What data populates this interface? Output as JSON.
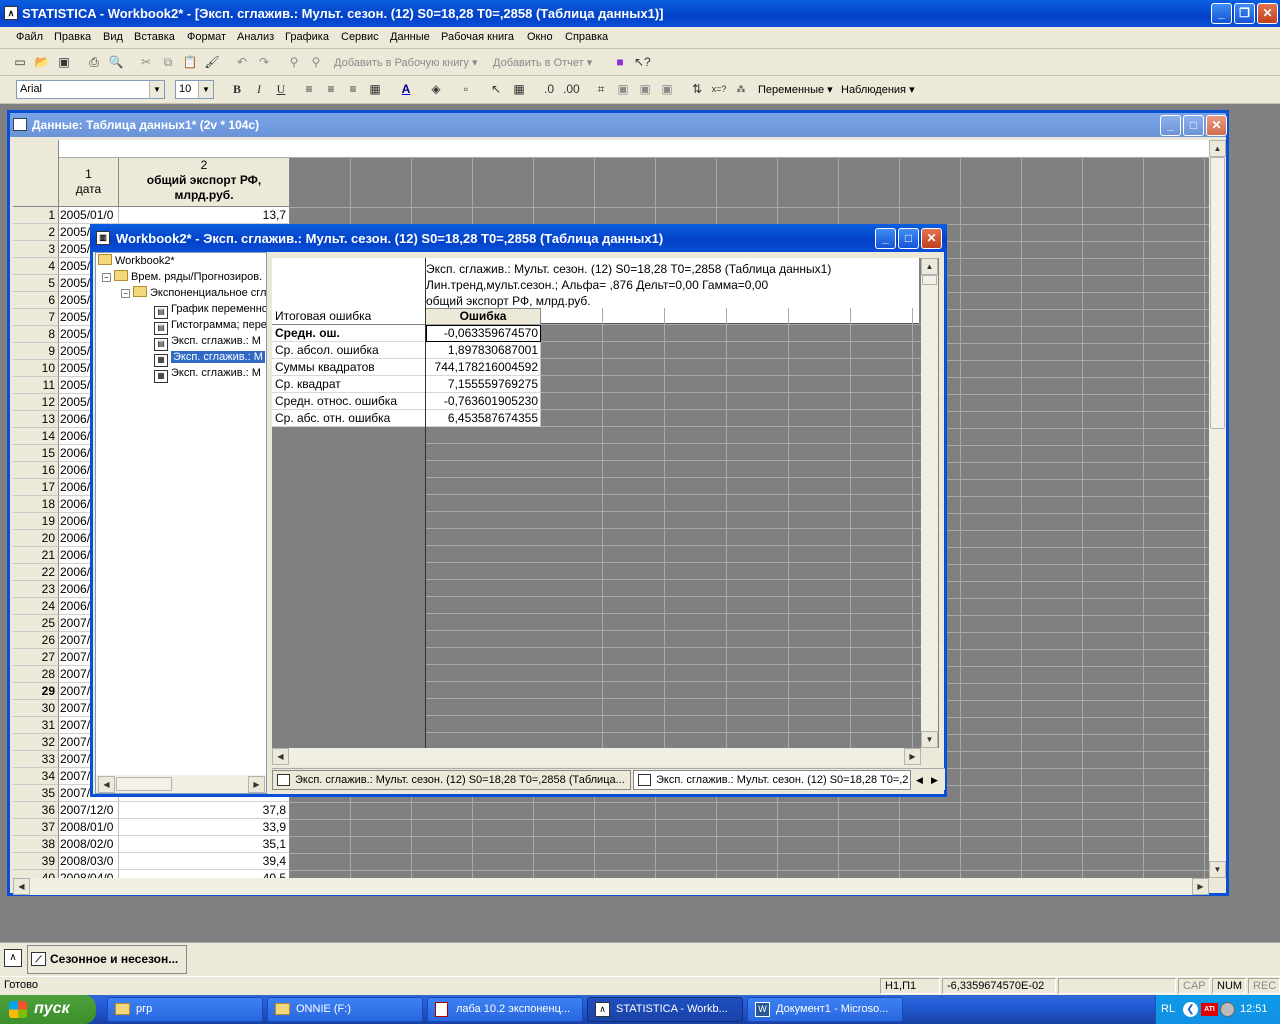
{
  "app": {
    "title": "STATISTICA - Workbook2* - [Эксп. сглажив.: Мульт. сезон. (12) S0=18,28 T0=,2858 (Таблица данных1)]"
  },
  "menu": [
    "Файл",
    "Правка",
    "Вид",
    "Вставка",
    "Формат",
    "Анализ",
    "Графика",
    "Сервис",
    "Данные",
    "Рабочая книга",
    "Окно",
    "Справка"
  ],
  "toolbar1": {
    "add_workbook": "Добавить в Рабочую книгу",
    "add_report": "Добавить в Отчет"
  },
  "toolbar2": {
    "font": "Arial",
    "size": "10",
    "variables": "Переменные",
    "cases": "Наблюдения"
  },
  "data_window": {
    "title": "Данные: Таблица данных1* (2v * 104c)",
    "col1_num": "1",
    "col1_name": "дата",
    "col2_num": "2",
    "col2_name": "общий экспорт РФ, млрд.руб.",
    "rows": [
      {
        "n": "1",
        "date": "2005/01/0",
        "val": "13,7"
      },
      {
        "n": "2",
        "date": "2005/",
        "val": ""
      },
      {
        "n": "3",
        "date": "2005/",
        "val": ""
      },
      {
        "n": "4",
        "date": "2005/",
        "val": ""
      },
      {
        "n": "5",
        "date": "2005/",
        "val": ""
      },
      {
        "n": "6",
        "date": "2005/",
        "val": ""
      },
      {
        "n": "7",
        "date": "2005/",
        "val": ""
      },
      {
        "n": "8",
        "date": "2005/",
        "val": ""
      },
      {
        "n": "9",
        "date": "2005/",
        "val": ""
      },
      {
        "n": "10",
        "date": "2005/",
        "val": ""
      },
      {
        "n": "11",
        "date": "2005/",
        "val": ""
      },
      {
        "n": "12",
        "date": "2005/",
        "val": ""
      },
      {
        "n": "13",
        "date": "2006/",
        "val": ""
      },
      {
        "n": "14",
        "date": "2006/",
        "val": ""
      },
      {
        "n": "15",
        "date": "2006/",
        "val": ""
      },
      {
        "n": "16",
        "date": "2006/",
        "val": ""
      },
      {
        "n": "17",
        "date": "2006/",
        "val": ""
      },
      {
        "n": "18",
        "date": "2006/",
        "val": ""
      },
      {
        "n": "19",
        "date": "2006/",
        "val": ""
      },
      {
        "n": "20",
        "date": "2006/",
        "val": ""
      },
      {
        "n": "21",
        "date": "2006/",
        "val": ""
      },
      {
        "n": "22",
        "date": "2006/",
        "val": ""
      },
      {
        "n": "23",
        "date": "2006/",
        "val": ""
      },
      {
        "n": "24",
        "date": "2006/",
        "val": ""
      },
      {
        "n": "25",
        "date": "2007/",
        "val": ""
      },
      {
        "n": "26",
        "date": "2007/",
        "val": ""
      },
      {
        "n": "27",
        "date": "2007/",
        "val": ""
      },
      {
        "n": "28",
        "date": "2007/",
        "val": ""
      },
      {
        "n": "29",
        "date": "2007/",
        "val": ""
      },
      {
        "n": "30",
        "date": "2007/",
        "val": ""
      },
      {
        "n": "31",
        "date": "2007/",
        "val": ""
      },
      {
        "n": "32",
        "date": "2007/",
        "val": ""
      },
      {
        "n": "33",
        "date": "2007/",
        "val": ""
      },
      {
        "n": "34",
        "date": "2007/",
        "val": ""
      },
      {
        "n": "35",
        "date": "2007/",
        "val": ""
      },
      {
        "n": "36",
        "date": "2007/12/0",
        "val": "37,8"
      },
      {
        "n": "37",
        "date": "2008/01/0",
        "val": "33,9"
      },
      {
        "n": "38",
        "date": "2008/02/0",
        "val": "35,1"
      },
      {
        "n": "39",
        "date": "2008/03/0",
        "val": "39,4"
      },
      {
        "n": "40",
        "date": "2008/04/0",
        "val": "40,5"
      }
    ]
  },
  "workbook": {
    "title": "Workbook2* - Эксп. сглажив.: Мульт. сезон. (12) S0=18,28 T0=,2858 (Таблица данных1)",
    "tree": {
      "root": "Workbook2*",
      "folder1": "Врем. ряды/Прогнозиров.",
      "folder2": "Экспоненциальное сгл",
      "items": [
        "График переменно",
        "Гистограмма; пере",
        "Эксп. сглажив.: М",
        "Эксп. сглажив.: М",
        "Эксп. сглажив.: М"
      ]
    },
    "sheet": {
      "header_lines": [
        "Эксп. сглажив.: Мульт. сезон. (12) S0=18,28 T0=,2858 (Таблица данных1)",
        "Лин.тренд,мульт.сезон.; Альфа= ,876 Дельт=0,00 Гамма=0,00",
        "общий экспорт РФ, млрд.руб."
      ],
      "row_header_title": "Итоговая ошибка",
      "col_header": "Ошибка",
      "rows": [
        {
          "label": "Средн. ош.",
          "value": "-0,063359674570"
        },
        {
          "label": "Ср. абсол. ошибка",
          "value": "1,897830687001"
        },
        {
          "label": "Суммы квадратов",
          "value": "744,178216004592"
        },
        {
          "label": "Ср. квадрат",
          "value": "7,155559769275"
        },
        {
          "label": "Средн. относ. ошибка",
          "value": "-0,763601905230"
        },
        {
          "label": "Ср. абс. отн. ошибка",
          "value": "6,453587674355"
        }
      ]
    },
    "tabs": [
      "Эксп. сглажив.: Мульт. сезон. (12) S0=18,28 T0=,2858 (Таблица...",
      "Эксп. сглажив.: Мульт. сезон. (12) S0=18,28 T0=,2"
    ]
  },
  "task_strip": {
    "item": "Сезонное и несезон..."
  },
  "status": {
    "ready": "Готово",
    "cell": "H1,П1",
    "value": "-6,3359674570E-02",
    "cap": "CAP",
    "num": "NUM",
    "rec": "REC"
  },
  "taskbar": {
    "start": "пуск",
    "tasks": [
      "ргр",
      "ONNIE (F:)",
      "лаба 10.2 экспоненц...",
      "STATISTICA - Workb...",
      "Документ1 - Microso..."
    ],
    "lang": "RL",
    "time": "12:51"
  }
}
